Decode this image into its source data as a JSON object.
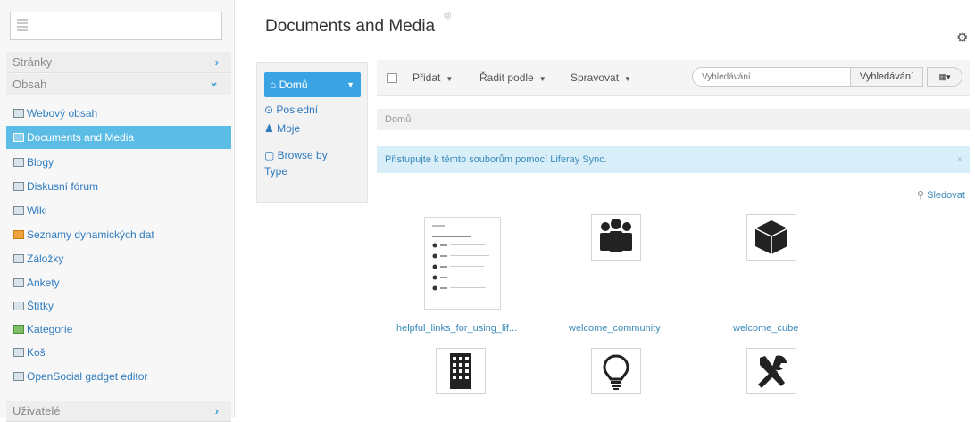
{
  "sidebar": {
    "sections": [
      {
        "label": "Stránky",
        "chevron": "›"
      },
      {
        "label": "Obsah",
        "chevron": "⌄"
      },
      {
        "label": "Uživatelé",
        "chevron": "›"
      }
    ],
    "items": [
      {
        "label": "Webový obsah",
        "icon": "web-content-icon"
      },
      {
        "label": "Documents and Media",
        "icon": "documents-icon",
        "active": true
      },
      {
        "label": "Blogy",
        "icon": "blogs-icon"
      },
      {
        "label": "Diskusní fórum",
        "icon": "forum-icon"
      },
      {
        "label": "Wiki",
        "icon": "wiki-icon"
      },
      {
        "label": "Seznamy dynamických dat",
        "icon": "dynamic-data-icon"
      },
      {
        "label": "Záložky",
        "icon": "bookmarks-icon"
      },
      {
        "label": "Ankety",
        "icon": "polls-icon"
      },
      {
        "label": "Štítky",
        "icon": "tags-icon"
      },
      {
        "label": "Kategorie",
        "icon": "categories-icon"
      },
      {
        "label": "Koš",
        "icon": "trash-icon"
      },
      {
        "label": "OpenSocial gadget editor",
        "icon": "gadget-icon"
      }
    ]
  },
  "header": {
    "title": "Documents and Media",
    "settings_icon": "⚙"
  },
  "nav": {
    "home": "Domů",
    "recent": "Poslední",
    "mine": "Moje",
    "browse": "Browse by Type"
  },
  "toolbar": {
    "add": "Přidat",
    "sort": "Řadit podle",
    "manage": "Spravovat",
    "search_placeholder": "Vyhledávání",
    "search_button": "Vyhledávání",
    "view_icon": "▦▾"
  },
  "breadcrumb": "Domů",
  "alert": {
    "text": "Přistupujte k těmto souborům pomocí Liferay Sync.",
    "close": "×"
  },
  "follow": "Sledovat",
  "files": [
    {
      "name": "helpful_links_for_using_lif...",
      "icon": "document-preview-icon"
    },
    {
      "name": "welcome_community",
      "icon": "community-icon"
    },
    {
      "name": "welcome_cube",
      "icon": "cube-icon"
    },
    {
      "name": "",
      "icon": "building-icon"
    },
    {
      "name": "",
      "icon": "lightbulb-icon"
    },
    {
      "name": "",
      "icon": "tools-icon"
    }
  ]
}
